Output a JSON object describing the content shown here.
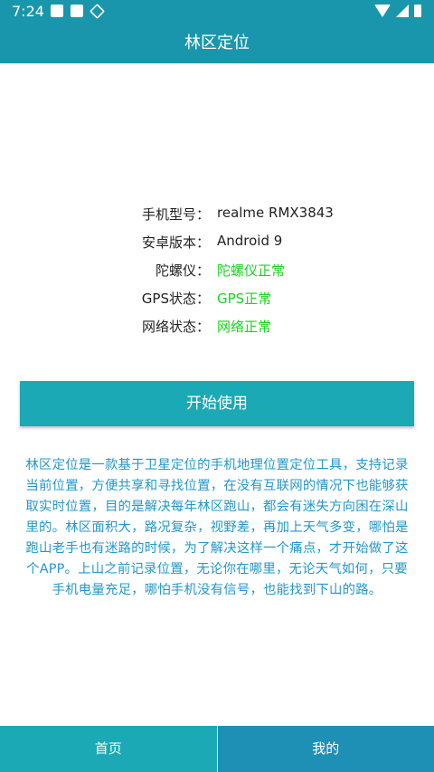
{
  "status_bar": {
    "time": "7:24"
  },
  "app_bar": {
    "title": "林区定位"
  },
  "info": {
    "rows": [
      {
        "label": "手机型号：",
        "value": "realme RMX3843"
      },
      {
        "label": "安卓版本：",
        "value": "Android 9"
      },
      {
        "label": "陀螺仪：",
        "value": "陀螺仪正常"
      },
      {
        "label": "GPS状态：",
        "value": "GPS正常"
      },
      {
        "label": "网络状态：",
        "value": "网络正常"
      }
    ]
  },
  "start_button": {
    "label": "开始使用"
  },
  "description": "林区定位是一款基于卫星定位的手机地理位置定位工具，支持记录当前位置，方便共享和寻找位置，在没有互联网的情况下也能够获取实时位置，目的是解决每年林区跑山，都会有迷失方向困在深山里的。林区面积大，路况复杂，视野差，再加上天气多变，哪怕是跑山老手也有迷路的时候，为了解决这样一个痛点，才开始做了这个APP。上山之前记录位置，无论你在哪里，无论天气如何，只要手机电量充足，哪怕手机没有信号，也能找到下山的路。",
  "bottom_nav": {
    "home": "首页",
    "mine": "我的"
  },
  "colors": {
    "primary": "#1a96ac",
    "button": "#1aa9b5",
    "ok_text": "#19d31f",
    "desc_text": "#2497c9"
  }
}
